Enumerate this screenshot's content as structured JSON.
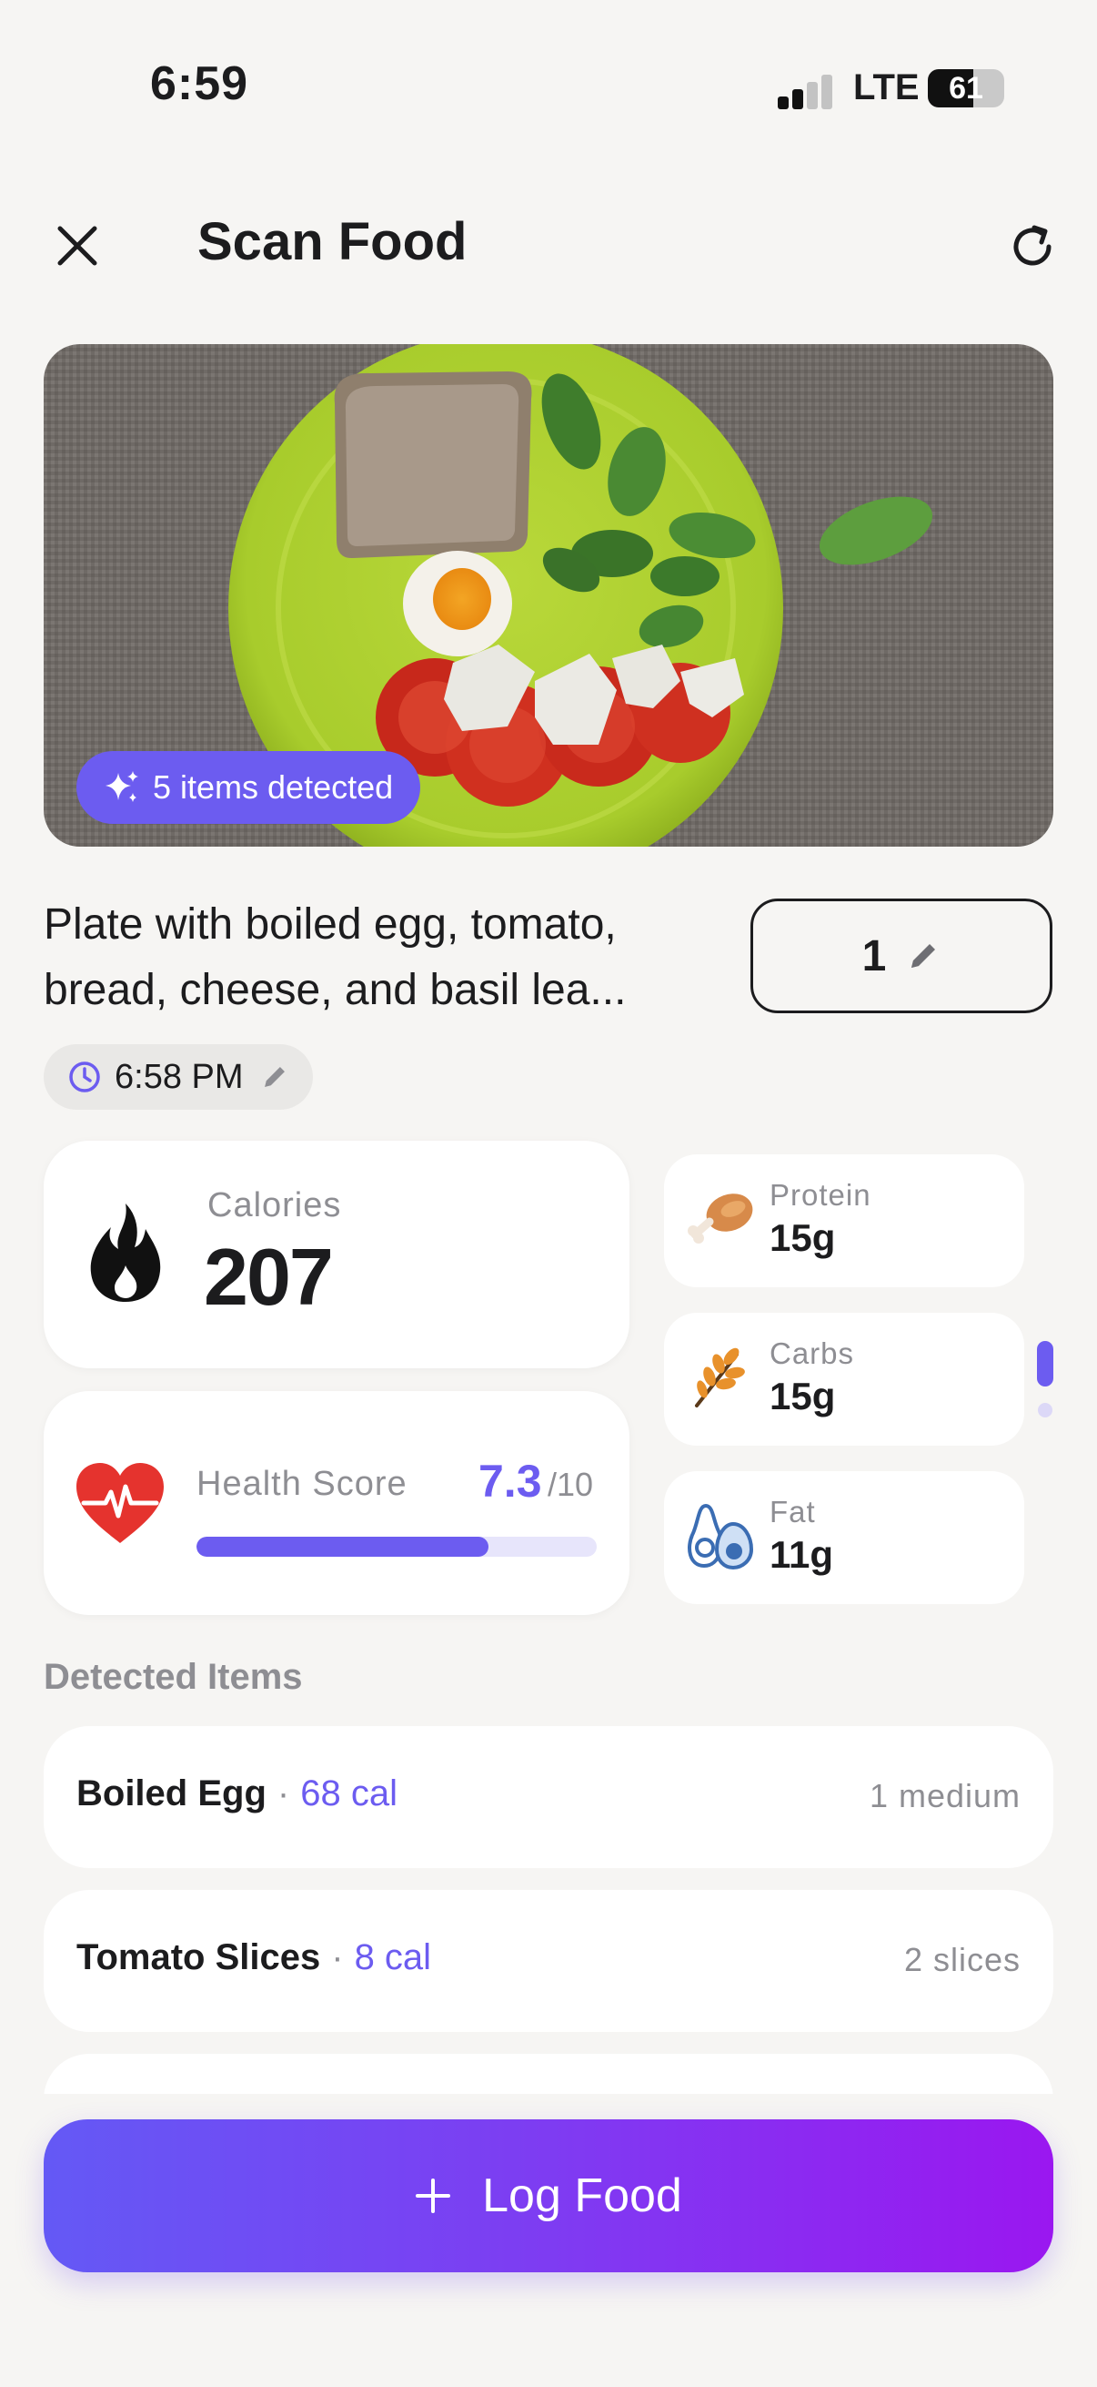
{
  "status_bar": {
    "time": "6:59",
    "network": "LTE",
    "battery": "61"
  },
  "header": {
    "title": "Scan Food"
  },
  "photo": {
    "badge": "5 items detected"
  },
  "meal": {
    "name_line1": "Plate with boiled egg, tomato,",
    "name_line2": "bread, cheese, and basil lea...",
    "servings": "1",
    "time": "6:58 PM"
  },
  "calories": {
    "label": "Calories",
    "value": "207"
  },
  "health_score": {
    "label": "Health Score",
    "score": "7.3",
    "max": "/10",
    "progress": 0.73
  },
  "macros": [
    {
      "label": "Protein",
      "value": "15g",
      "icon": "drumstick-icon"
    },
    {
      "label": "Carbs",
      "value": "15g",
      "icon": "wheat-icon"
    },
    {
      "label": "Fat",
      "value": "11g",
      "icon": "avocado-icon"
    }
  ],
  "detected": {
    "title": "Detected Items",
    "items": [
      {
        "name": "Boiled Egg",
        "sep": "·",
        "cal": "68 cal",
        "qty": "1 medium"
      },
      {
        "name": "Tomato Slices",
        "sep": "·",
        "cal": "8 cal",
        "qty": "2 slices"
      }
    ]
  },
  "actions": {
    "log_label": "Log Food"
  },
  "colors": {
    "accent": "#6c5cf0",
    "gradient_start": "#6459f5",
    "gradient_end": "#9a17f0"
  }
}
